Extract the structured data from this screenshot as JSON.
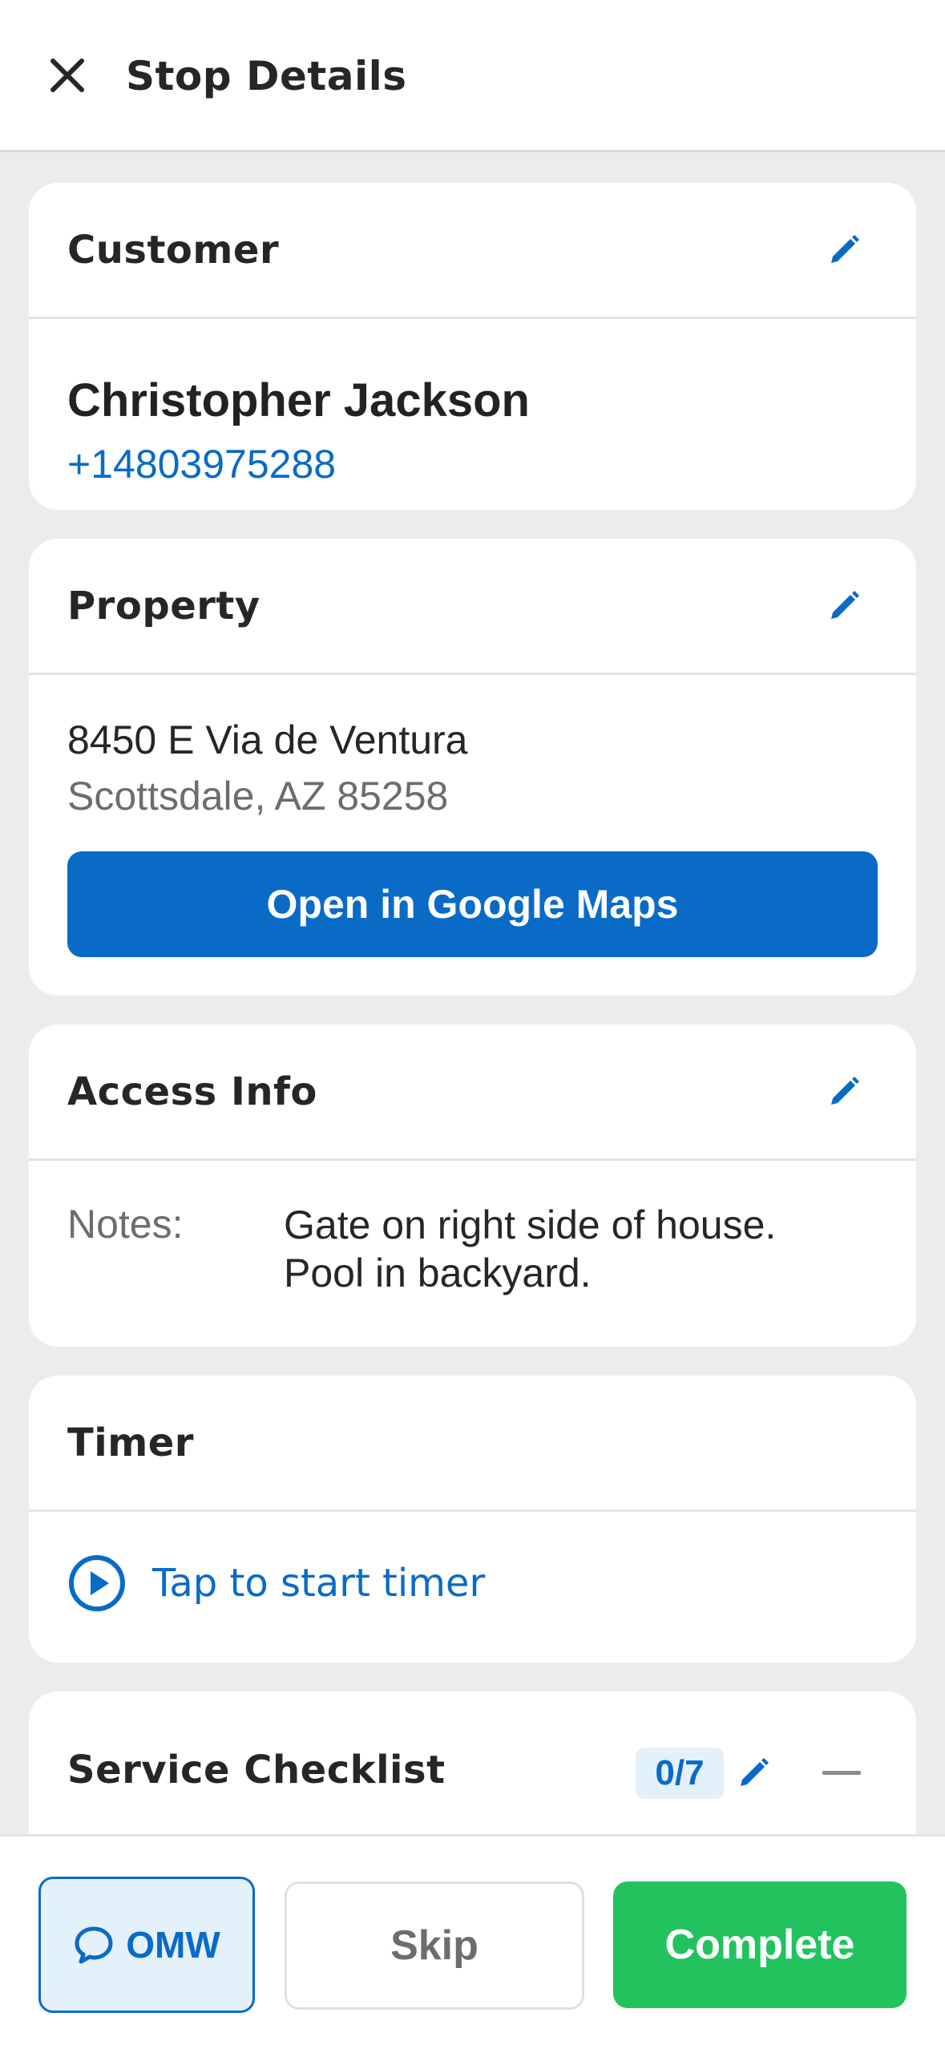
{
  "header": {
    "title": "Stop Details",
    "close_icon": "close-icon"
  },
  "customer": {
    "section_title": "Customer",
    "name": "Christopher Jackson",
    "phone": "+14803975288"
  },
  "property": {
    "section_title": "Property",
    "address_line1": "8450 E Via de Ventura",
    "address_line2": "Scottsdale, AZ 85258",
    "maps_button_label": "Open in Google Maps"
  },
  "access_info": {
    "section_title": "Access Info",
    "notes_label": "Notes:",
    "notes_line1": "Gate on right side of house.",
    "notes_line2": "Pool in backyard."
  },
  "timer": {
    "section_title": "Timer",
    "start_label": "Tap to start timer"
  },
  "service_checklist": {
    "section_title": "Service Checklist",
    "progress": "0/7"
  },
  "actions": {
    "omw_label": "OMW",
    "skip_label": "Skip",
    "complete_label": "Complete"
  },
  "colors": {
    "accent_blue": "#0a6bc7",
    "complete_green": "#22c35e",
    "background_gray": "#ececec"
  }
}
